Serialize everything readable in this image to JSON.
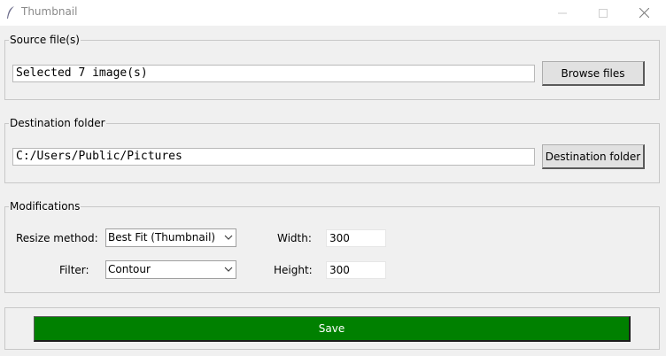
{
  "window": {
    "title": "Thumbnail",
    "icon": "feather-icon"
  },
  "source": {
    "legend": "Source file(s)",
    "value": "Selected 7 image(s)",
    "browse_label": "Browse files"
  },
  "destination": {
    "legend": "Destination folder",
    "value": "C:/Users/Public/Pictures",
    "button_label": "Destination folder"
  },
  "modifications": {
    "legend": "Modifications",
    "resize_method_label": "Resize method:",
    "resize_method_value": "Best Fit (Thumbnail)",
    "filter_label": "Filter:",
    "filter_value": "Contour",
    "width_label": "Width:",
    "width_value": "300",
    "height_label": "Height:",
    "height_value": "300"
  },
  "actions": {
    "save_label": "Save"
  },
  "colors": {
    "save_button_bg": "#008000",
    "window_bg": "#f0f0f0"
  }
}
